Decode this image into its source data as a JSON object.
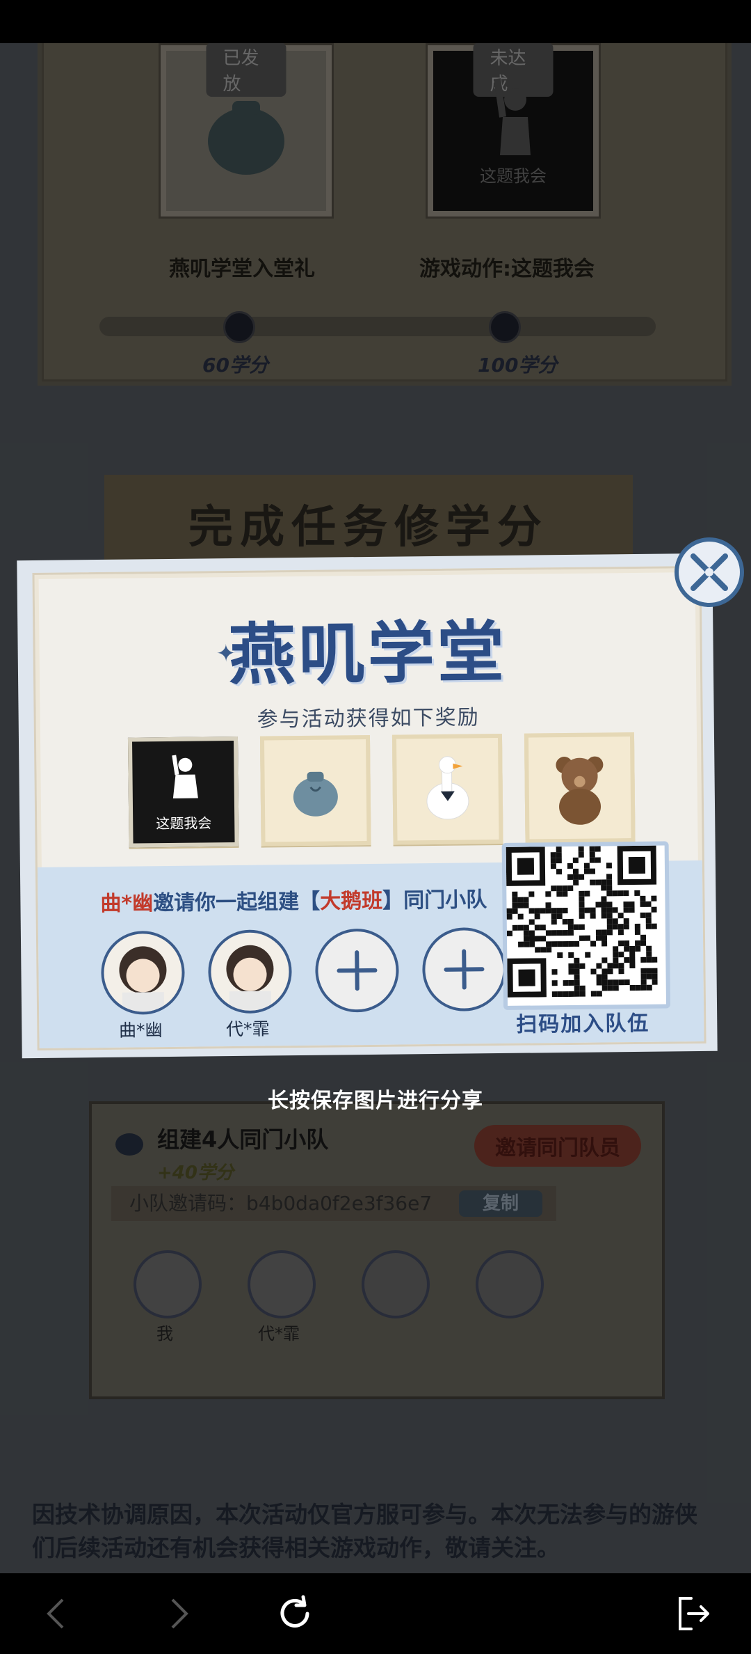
{
  "background": {
    "rewards": [
      {
        "tag": "已发放",
        "title": "燕叽学堂入堂礼",
        "score": "60学分"
      },
      {
        "tag": "未达成",
        "title": "游戏动作:这题我会",
        "score": "100学分",
        "image_caption": "这题我会"
      }
    ],
    "banner": "完成任务修学分",
    "team_task": {
      "title": "组建4人同门小队",
      "points": "+40学分",
      "invite_button": "邀请同门队员",
      "code_label": "小队邀请码：b4b0da0f2e3f36e7",
      "copy_button": "复制",
      "members": [
        "我",
        "代*霏"
      ]
    },
    "notice": "因技术协调原因，本次活动仅官方服可参与。本次无法参与的游侠们后续活动还有机会获得相关游戏动作，敬请关注。"
  },
  "share_card": {
    "logo": "燕叽学堂",
    "subtitle": "参与活动获得如下奖励",
    "rewards": [
      {
        "icon": "pose-icon",
        "caption": "这题我会"
      },
      {
        "icon": "pouch-icon"
      },
      {
        "icon": "goose-icon"
      },
      {
        "icon": "bear-icon"
      }
    ],
    "invite": {
      "inviter": "曲*幽",
      "text_a": "邀请你一起组建【",
      "team": "大鹅班",
      "text_b": "】同门小队"
    },
    "members": [
      "曲*幽",
      "代*霏"
    ],
    "qr_caption": "扫码加入队伍"
  },
  "save_hint": "长按保存图片进行分享",
  "colors": {
    "accent": "#2c4d86",
    "highlight": "#c23a2b"
  }
}
